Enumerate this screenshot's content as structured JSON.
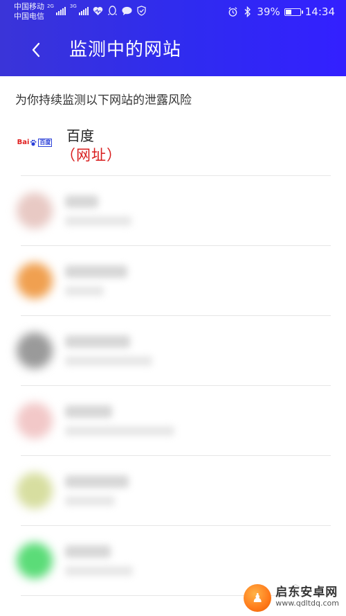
{
  "status_bar": {
    "carrier_1": "中国移动",
    "carrier_2": "中国电信",
    "net_1": "2G",
    "net_2": "3G",
    "battery_text": "39%",
    "battery_level": 0.39,
    "time": "14:34"
  },
  "header": {
    "back_icon": "chevron-left-icon",
    "title": "监测中的网站"
  },
  "subtitle": "为你持续监测以下网站的泄露风险",
  "sites": [
    {
      "name": "百度",
      "url": "（网址）",
      "logo_text_1": "Bai",
      "logo_text_2": "百度"
    }
  ],
  "blurred_rows": [
    {
      "logo_color": "#e8c9c4"
    },
    {
      "logo_color": "#f0a050"
    },
    {
      "logo_color": "#9a9a9a"
    },
    {
      "logo_color": "#f2c8c8"
    },
    {
      "logo_color": "#d7dea0"
    },
    {
      "logo_color": "#5bdc78"
    }
  ],
  "watermark": {
    "name": "启东安卓网",
    "url": "www.qdltdq.com"
  },
  "colors": {
    "header_start": "#3a34d8",
    "header_end": "#3320ff",
    "url_red": "#d81b1b"
  }
}
